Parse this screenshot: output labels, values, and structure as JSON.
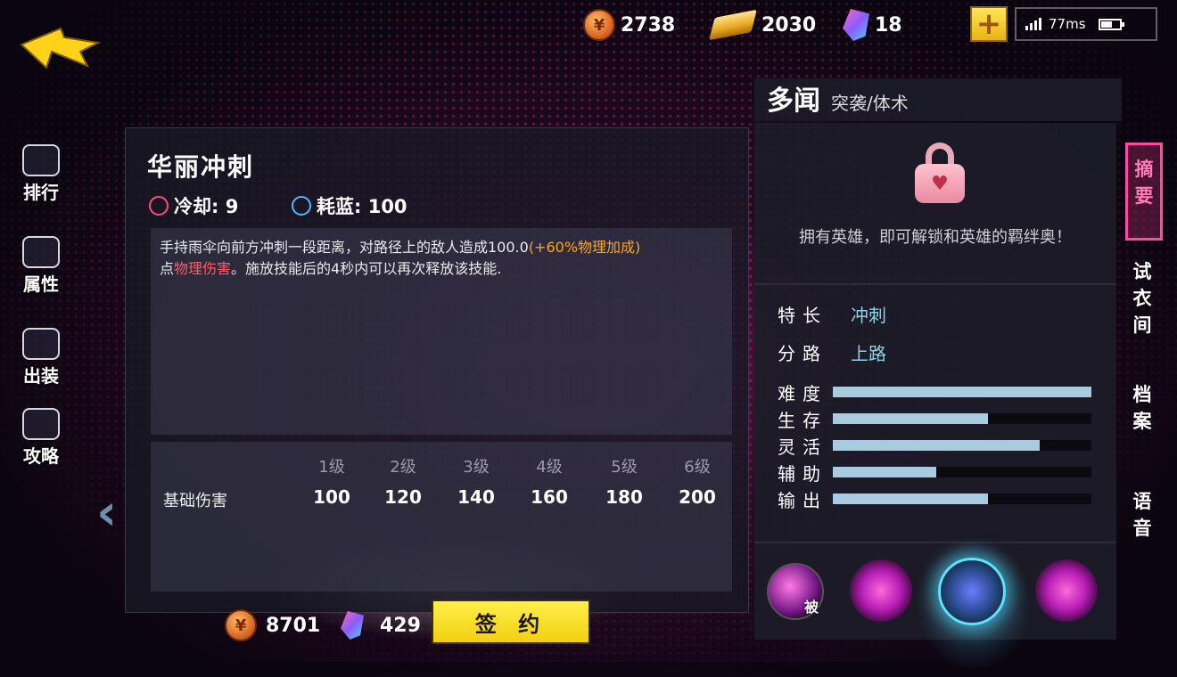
{
  "currency": {
    "coins": "2738",
    "gold": "2030",
    "gems": "18"
  },
  "status": {
    "ping": "77ms"
  },
  "left_nav": [
    {
      "label": "排行",
      "icon": "ranking-icon"
    },
    {
      "label": "属性",
      "icon": "attributes-icon"
    },
    {
      "label": "出装",
      "icon": "equipment-icon"
    },
    {
      "label": "攻略",
      "icon": "guide-icon"
    }
  ],
  "skill": {
    "title": "华丽冲刺",
    "cooldown_label": "冷却: 9",
    "mana_label": "耗蓝: 100",
    "desc_part1": "手持雨伞向前方冲刺一段距离，对路径上的敌人造成100.0",
    "desc_bonus": "(+60%物理加成)",
    "desc_part2": "点",
    "desc_damage_type": "物理伤害",
    "desc_part3": "。施放技能后的4秒内可以再次释放该技能.",
    "damage_label": "基础伤害",
    "levels": [
      "1级",
      "2级",
      "3级",
      "4级",
      "5级",
      "6级"
    ],
    "values": [
      "100",
      "120",
      "140",
      "160",
      "180",
      "200"
    ]
  },
  "bottom": {
    "coins": "8701",
    "gems": "429",
    "sign_label": "签 约"
  },
  "hero": {
    "name": "多闻",
    "role": "突袭/体术",
    "unlock_text": "拥有英雄，即可解锁和英雄的羁绊奥！",
    "traits": [
      {
        "key": "特长",
        "value": "冲刺"
      },
      {
        "key": "分路",
        "value": "上路"
      }
    ],
    "bars": [
      {
        "label": "难度",
        "fraction": 1.0
      },
      {
        "label": "生存",
        "fraction": 0.6
      },
      {
        "label": "灵活",
        "fraction": 0.8
      },
      {
        "label": "辅助",
        "fraction": 0.4
      },
      {
        "label": "输出",
        "fraction": 0.6
      }
    ],
    "passive_badge": "被"
  },
  "tabs": {
    "summary": "摘要",
    "fitting": "试衣间",
    "archive": "档案",
    "voice": "语音"
  },
  "colors": {
    "accent_pink": "#ff4aa0",
    "bonus_orange": "#f5a623",
    "damage_red": "#ff5a6a",
    "bar_blue": "#a8cbdf"
  }
}
